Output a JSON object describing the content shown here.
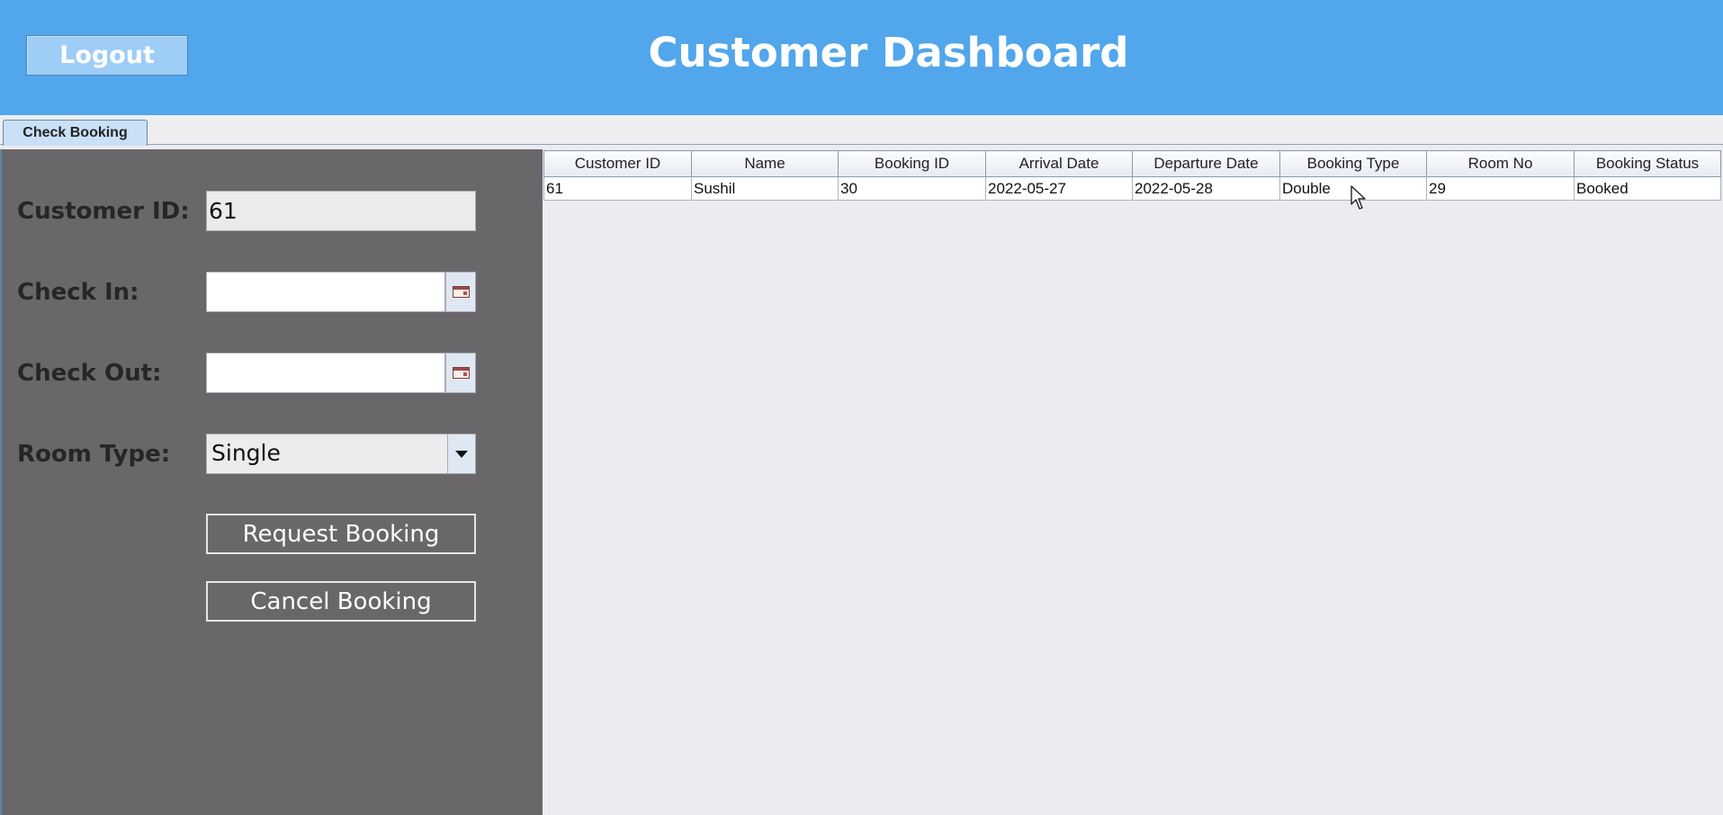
{
  "header": {
    "logout_label": "Logout",
    "title": "Customer Dashboard",
    "background": "#51a6ec"
  },
  "tabs": [
    {
      "label": "Check Booking",
      "selected": true
    }
  ],
  "form": {
    "customer_id": {
      "label": "Customer ID:",
      "value": "61"
    },
    "check_in": {
      "label": "Check In:",
      "value": "",
      "button_icon": "calendar-icon"
    },
    "check_out": {
      "label": "Check Out:",
      "value": "",
      "button_icon": "calendar-icon"
    },
    "room_type": {
      "label": "Room Type:",
      "value": "Single"
    },
    "request_label": "Request Booking",
    "cancel_label": "Cancel Booking",
    "panel_color": "#69676a"
  },
  "table": {
    "columns": [
      "Customer ID",
      "Name",
      "Booking ID",
      "Arrival Date",
      "Departure Date",
      "Booking Type",
      "Room No",
      "Booking Status"
    ],
    "rows": [
      [
        "61",
        "Sushil",
        "30",
        "2022-05-27",
        "2022-05-28",
        "Double",
        "29",
        "Booked"
      ]
    ]
  }
}
